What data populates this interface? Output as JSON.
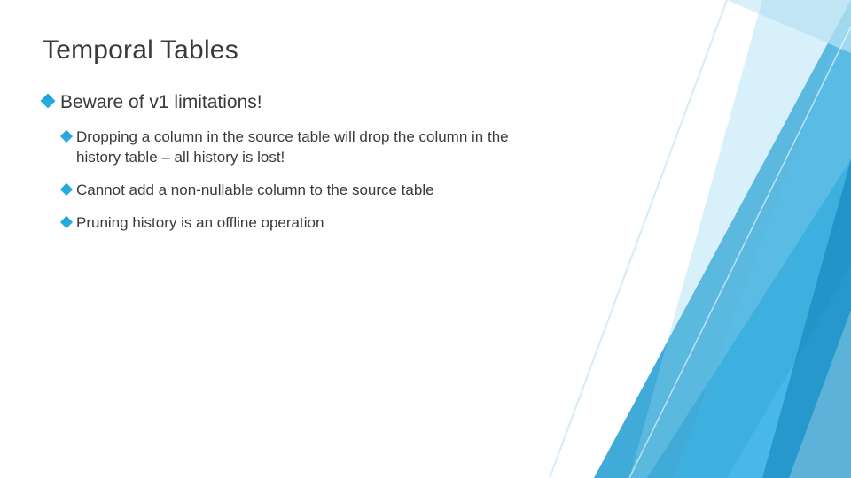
{
  "title": "Temporal Tables",
  "bullet1": {
    "text": "Beware of v1 limitations!"
  },
  "sub": {
    "b1": "Dropping a column in the source table will drop the column in the history table – all history is lost!",
    "b2": "Cannot add a non-nullable column to the source table",
    "b3": "Pruning history is an offline operation"
  }
}
